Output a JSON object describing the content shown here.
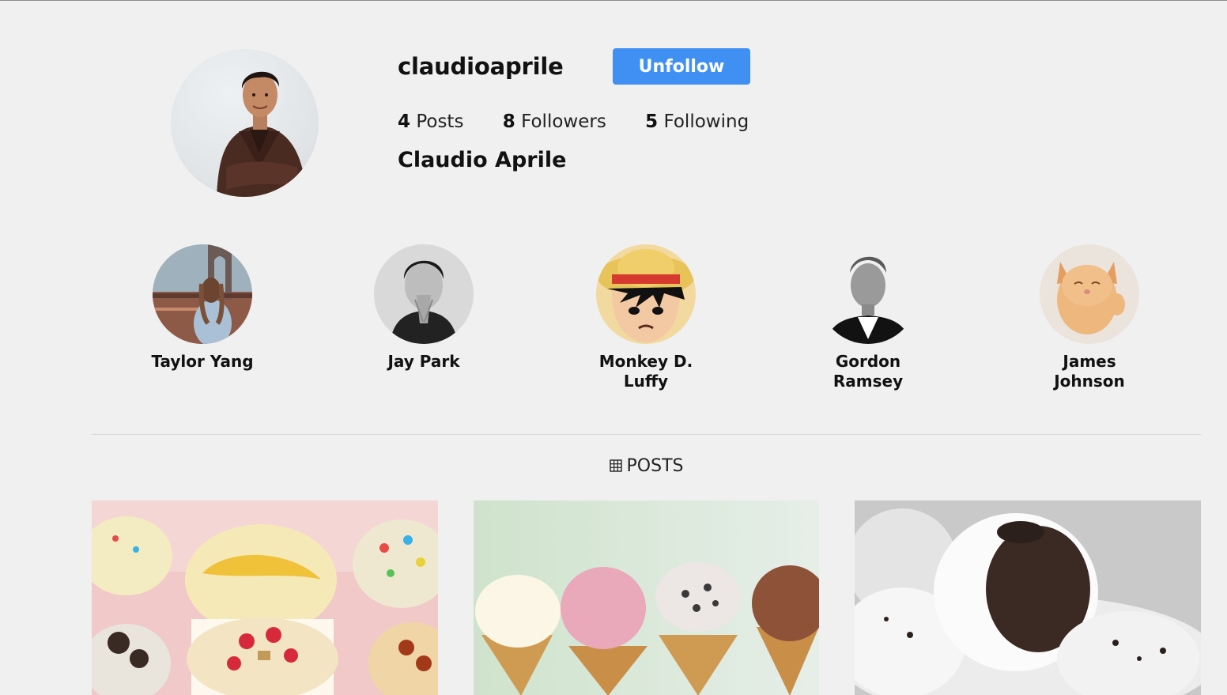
{
  "profile": {
    "username": "claudioaprile",
    "follow_button_label": "Unfollow",
    "posts_count": "4",
    "posts_label": "Posts",
    "followers_count": "8",
    "followers_label": "Followers",
    "following_count": "5",
    "following_label": "Following",
    "full_name": "Claudio Aprile"
  },
  "following": [
    {
      "name": "Taylor Yang"
    },
    {
      "name": "Jay Park"
    },
    {
      "name": "Monkey D. Luffy"
    },
    {
      "name": "Gordon Ramsey"
    },
    {
      "name": "James Johnson"
    }
  ],
  "posts_section": {
    "label": "POSTS",
    "icon": "grid-icon"
  },
  "colors": {
    "background": "#f0f0f0",
    "accent": "#4090f4"
  }
}
